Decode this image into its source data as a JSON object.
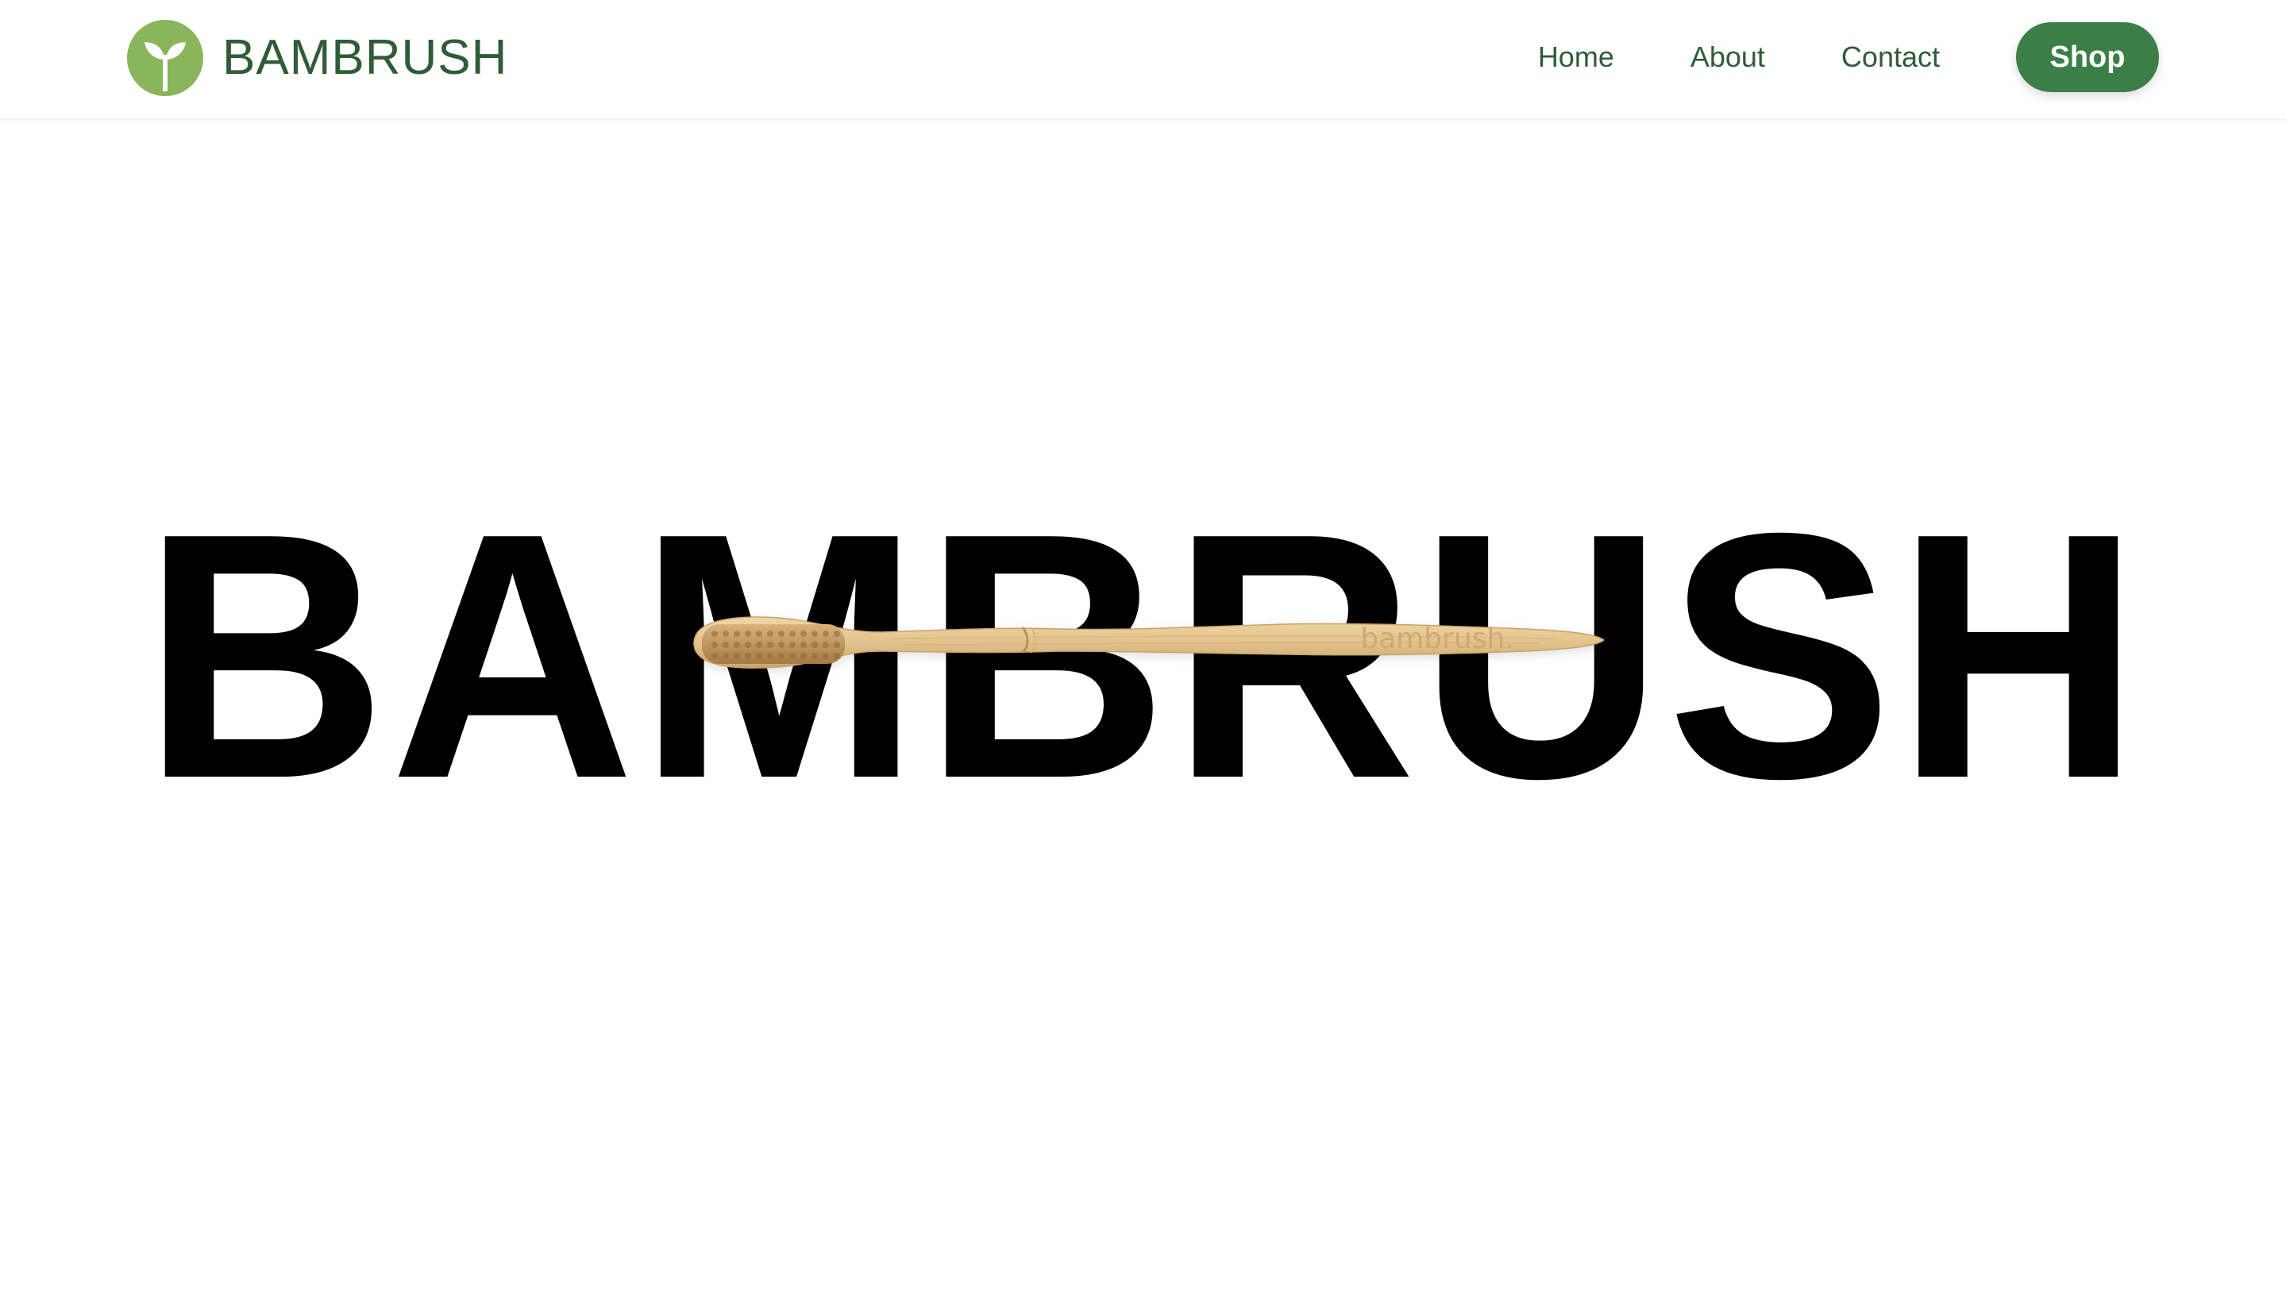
{
  "header": {
    "brand_name": "BAMBRUSH",
    "logo_icon": "sprout-leaf-icon",
    "nav": {
      "home_label": "Home",
      "about_label": "About",
      "contact_label": "Contact"
    },
    "shop_label": "Shop"
  },
  "hero": {
    "title": "BAMBRUSH",
    "product_image": "bamboo-toothbrush",
    "engraving": "bambrush."
  },
  "colors": {
    "brand_green_dark": "#2f5c36",
    "logo_green": "#8ab55a",
    "shop_button_bg": "#3c7f46",
    "hero_text": "#000000",
    "bamboo": "#e3c48e"
  }
}
